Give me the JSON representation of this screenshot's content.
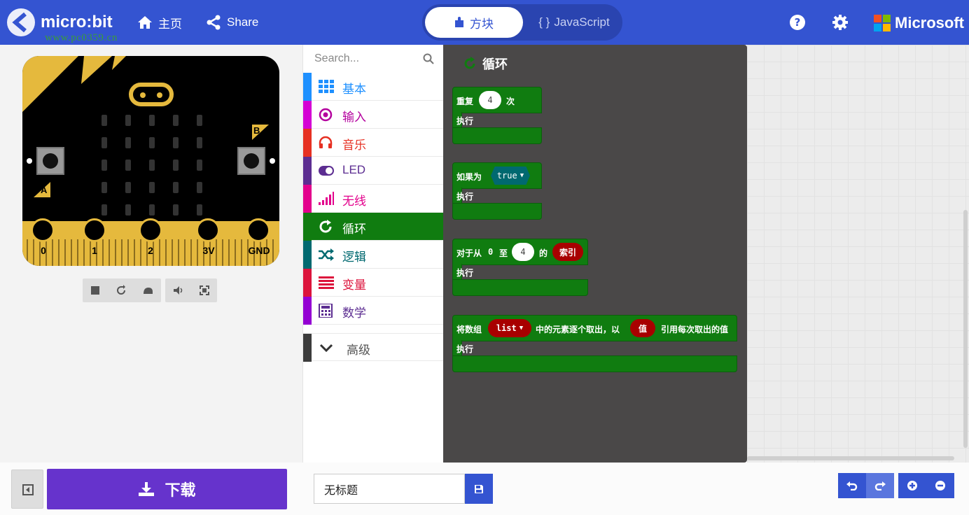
{
  "header": {
    "logo_text": "micro:bit",
    "watermark_text": "www.pc0359.cn",
    "home_label": "主页",
    "share_label": "Share",
    "editor_toggle": {
      "blocks_label": "方块",
      "js_label": "JavaScript"
    },
    "microsoft_label": "Microsoft",
    "icons": [
      "home-icon",
      "share-icon",
      "help-icon",
      "gear-icon"
    ]
  },
  "simulator": {
    "pin_labels": [
      "0",
      "1",
      "2",
      "3V",
      "GND"
    ],
    "button_a_label": "A",
    "button_b_label": "B",
    "tools": [
      "stop-icon",
      "restart-icon",
      "slow-mo-icon",
      "mute-icon",
      "fullscreen-icon"
    ]
  },
  "toolbox": {
    "search_placeholder": "Search...",
    "categories": [
      {
        "label": "基本",
        "color": "#1e90ff",
        "icon": "grid-icon"
      },
      {
        "label": "输入",
        "color": "#d400d4",
        "icon": "input-icon"
      },
      {
        "label": "音乐",
        "color": "#e63022",
        "icon": "headphones-icon"
      },
      {
        "label": "LED",
        "color": "#5c2d91",
        "icon": "toggle-icon"
      },
      {
        "label": "无线",
        "color": "#e3008c",
        "icon": "signal-icon"
      },
      {
        "label": "循环",
        "color": "#107c10",
        "icon": "refresh-icon",
        "selected": true
      },
      {
        "label": "逻辑",
        "color": "#006970",
        "icon": "shuffle-icon"
      },
      {
        "label": "变量",
        "color": "#dc143c",
        "icon": "variables-icon"
      },
      {
        "label": "数学",
        "color": "#9400d3",
        "icon": "calculator-icon"
      }
    ],
    "advanced_label": "高级"
  },
  "flyout": {
    "title": "循环",
    "blocks": [
      {
        "prefix": "重复",
        "value": "4",
        "suffix": "次",
        "do": "执行"
      },
      {
        "prefix": "如果为",
        "value": "true",
        "do": "执行"
      },
      {
        "prefix": "对于从",
        "from": "0",
        "to_label": "至",
        "value": "4",
        "of_label": "的",
        "var": "索引",
        "do": "执行"
      },
      {
        "prefix": "将数组",
        "list": "list",
        "mid": "中的元素逐个取出，以",
        "var": "值",
        "suffix": "引用每次取出的值",
        "do": "执行"
      }
    ]
  },
  "footer": {
    "download_label": "下载",
    "project_name": "无标题",
    "controls": [
      "undo-icon",
      "redo-icon",
      "zoom-in-icon",
      "zoom-out-icon"
    ]
  }
}
